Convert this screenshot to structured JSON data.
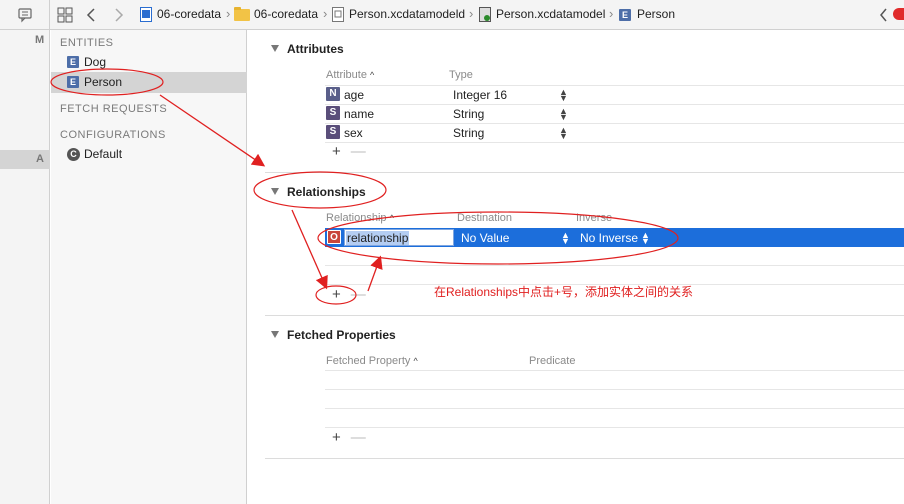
{
  "jumpbar": {
    "crumbs": [
      "06-coredata",
      "06-coredata",
      "Person.xcdatamodeld",
      "Person.xcdatamodel",
      "Person"
    ]
  },
  "gutter": {
    "m_label": "M",
    "a_label": "A"
  },
  "outline": {
    "entities_header": "ENTITIES",
    "entities": [
      {
        "badge": "E",
        "label": "Dog"
      },
      {
        "badge": "E",
        "label": "Person"
      }
    ],
    "fetch_requests_header": "FETCH REQUESTS",
    "configurations_header": "CONFIGURATIONS",
    "configurations": [
      {
        "badge": "C",
        "label": "Default"
      }
    ]
  },
  "attributes": {
    "title": "Attributes",
    "col_attribute": "Attribute",
    "col_type": "Type",
    "rows": [
      {
        "badge": "N",
        "name": "age",
        "type": "Integer 16"
      },
      {
        "badge": "S",
        "name": "name",
        "type": "String"
      },
      {
        "badge": "S",
        "name": "sex",
        "type": "String"
      }
    ]
  },
  "relationships": {
    "title": "Relationships",
    "col_relationship": "Relationship",
    "col_destination": "Destination",
    "col_inverse": "Inverse",
    "row": {
      "badge": "O",
      "name": "relationship",
      "destination": "No Value",
      "inverse": "No Inverse"
    }
  },
  "fetched": {
    "title": "Fetched Properties",
    "col_property": "Fetched Property",
    "col_predicate": "Predicate"
  },
  "controls": {
    "plus": "+",
    "minus": "—",
    "sort_icon": "^"
  },
  "annotation": "在Relationships中点击+号，添加实体之间的关系",
  "colors": {
    "selection": "#1c6edb",
    "annotation": "#e02020",
    "entity_badge": "#4d6ea8"
  }
}
